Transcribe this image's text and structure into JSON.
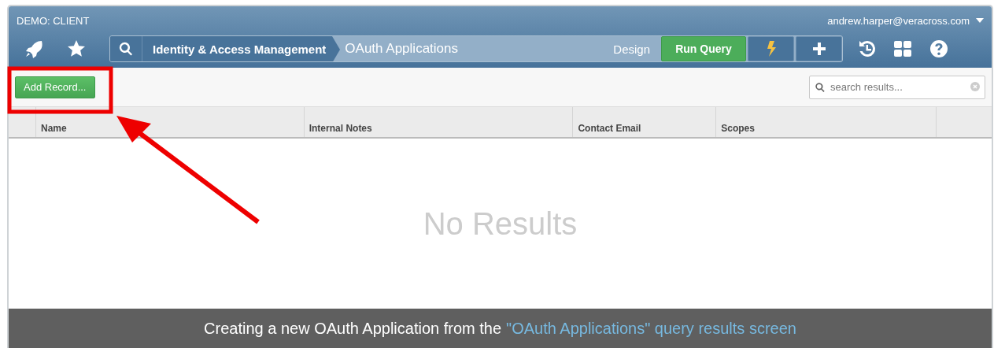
{
  "header": {
    "environment": "DEMO: CLIENT",
    "user": "andrew.harper@veracross.com"
  },
  "breadcrumb": [
    "Identity & Access Management",
    "OAuth Applications"
  ],
  "query_bar": {
    "design": "Design",
    "run": "Run Query"
  },
  "toolbar": {
    "add_button": "Add Record...",
    "search": {
      "placeholder": "search results..."
    }
  },
  "table": {
    "columns": [
      "Name",
      "Internal Notes",
      "Contact Email",
      "Scopes"
    ],
    "empty_message": "No Results"
  },
  "caption": {
    "text": "Creating a new OAuth Application from the ",
    "link": "\"OAuth Applications\" query results screen"
  }
}
